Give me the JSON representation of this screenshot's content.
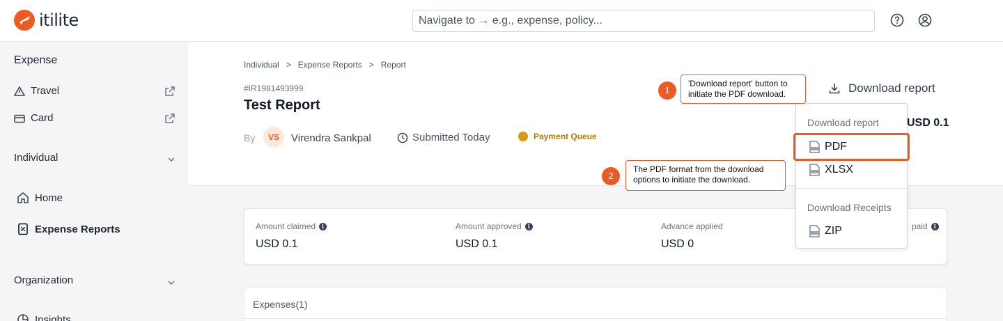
{
  "app": {
    "logo_text": "itilite"
  },
  "header": {
    "search_placeholder": "Navigate to → e.g., expense, policy...",
    "help_icon": "help-circle-icon",
    "user_icon": "user-circle-icon"
  },
  "sidebar": {
    "section_expense": "Expense",
    "travel": "Travel",
    "card": "Card",
    "section_individual": "Individual",
    "home": "Home",
    "expense_reports": "Expense Reports",
    "section_organization": "Organization",
    "insights": "Insights"
  },
  "breadcrumb": [
    "Individual",
    ">",
    "Expense Reports",
    ">",
    "Report"
  ],
  "report": {
    "id": "#IR1981493999",
    "title": "Test Report",
    "by_label": "By",
    "avatar_initials": "VS",
    "user_name": "Virendra Sankpal",
    "submitted": "Submitted Today",
    "status": "Payment Queue",
    "total": "USD 0.1",
    "download_label": "Download report"
  },
  "summary": [
    {
      "label": "Amount claimed",
      "value": "USD 0.1"
    },
    {
      "label": "Amount approved",
      "value": "USD 0.1"
    },
    {
      "label": "Advance applied",
      "value": "USD 0"
    },
    {
      "label": "paid",
      "value": ""
    }
  ],
  "expenses_title": "Expenses(1)",
  "dropdown": {
    "report_header": "Download report",
    "pdf": "PDF",
    "xlsx": "XLSX",
    "receipts_header": "Download Receipts",
    "zip": "ZIP"
  },
  "callouts": {
    "one_num": "1",
    "one_text": "'Download report' button to initiate the PDF download.",
    "two_num": "2",
    "two_text": "The PDF format from the download options to initiate the download."
  },
  "colors": {
    "brand": "#ec5b24",
    "status": "#d89a12"
  }
}
